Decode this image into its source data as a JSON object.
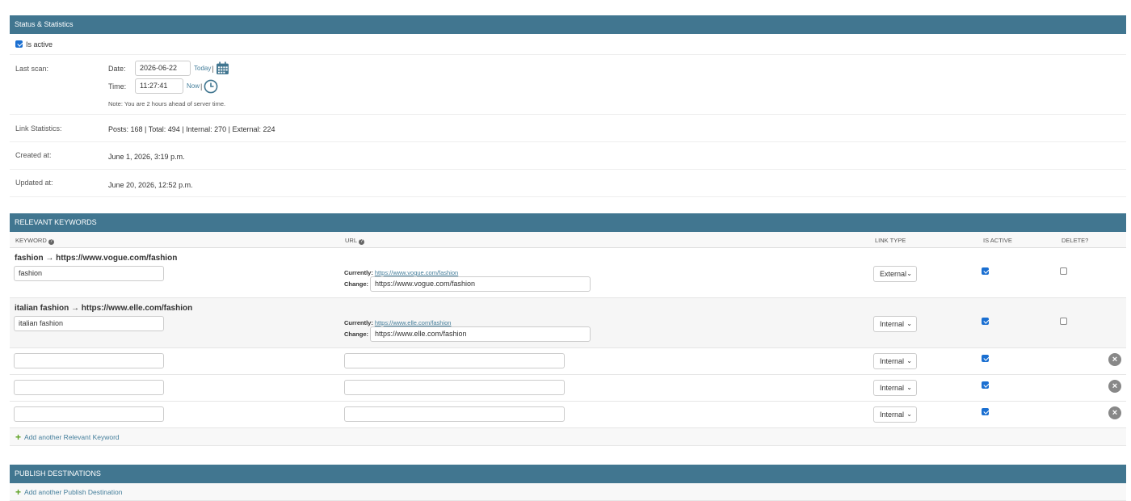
{
  "status": {
    "header": "Status & Statistics",
    "is_active_label": "Is active",
    "last_scan_label": "Last scan:",
    "date_label": "Date:",
    "date_value": "2026-06-22",
    "today_link": "Today",
    "time_label": "Time:",
    "time_value": "11:27:41",
    "now_link": "Now",
    "separator": "|",
    "note": "Note: You are 2 hours ahead of server time.",
    "link_stats_label": "Link Statistics:",
    "link_stats_value": "Posts: 168 | Total: 494 | Internal: 270 | External: 224",
    "created_label": "Created at:",
    "created_value": "June 1, 2026, 3:19 p.m.",
    "updated_label": "Updated at:",
    "updated_value": "June 20, 2026, 12:52 p.m."
  },
  "keywords": {
    "header": "RELEVANT KEYWORDS",
    "columns": {
      "keyword": "KEYWORD",
      "url": "URL",
      "link_type": "LINK TYPE",
      "is_active": "IS ACTIVE",
      "delete": "DELETE?"
    },
    "currently_label": "Currently:",
    "change_label": "Change:",
    "rows": [
      {
        "title": "fashion → https://www.vogue.com/fashion",
        "keyword": "fashion",
        "currently": "https://www.vogue.com/fashion",
        "change": "https://www.vogue.com/fashion",
        "link_type": "External"
      },
      {
        "title": "italian fashion → https://www.elle.com/fashion",
        "keyword": "italian fashion",
        "currently": "https://www.elle.com/fashion",
        "change": "https://www.elle.com/fashion",
        "link_type": "Internal"
      }
    ],
    "empty_rows": [
      {
        "link_type": "Internal"
      },
      {
        "link_type": "Internal"
      },
      {
        "link_type": "Internal"
      }
    ],
    "add_label": "Add another Relevant Keyword"
  },
  "publish": {
    "header": "PUBLISH DESTINATIONS",
    "add_label": "Add another Publish Destination"
  },
  "icons": {
    "calendar": "calendar-icon",
    "clock": "clock-icon",
    "help": "help-icon",
    "delete": "close-icon",
    "add": "plus-icon"
  },
  "colors": {
    "header_bg": "#417690",
    "link": "#447e9b",
    "checkbox": "#1a6fd1",
    "add_plus": "#5fa225"
  }
}
